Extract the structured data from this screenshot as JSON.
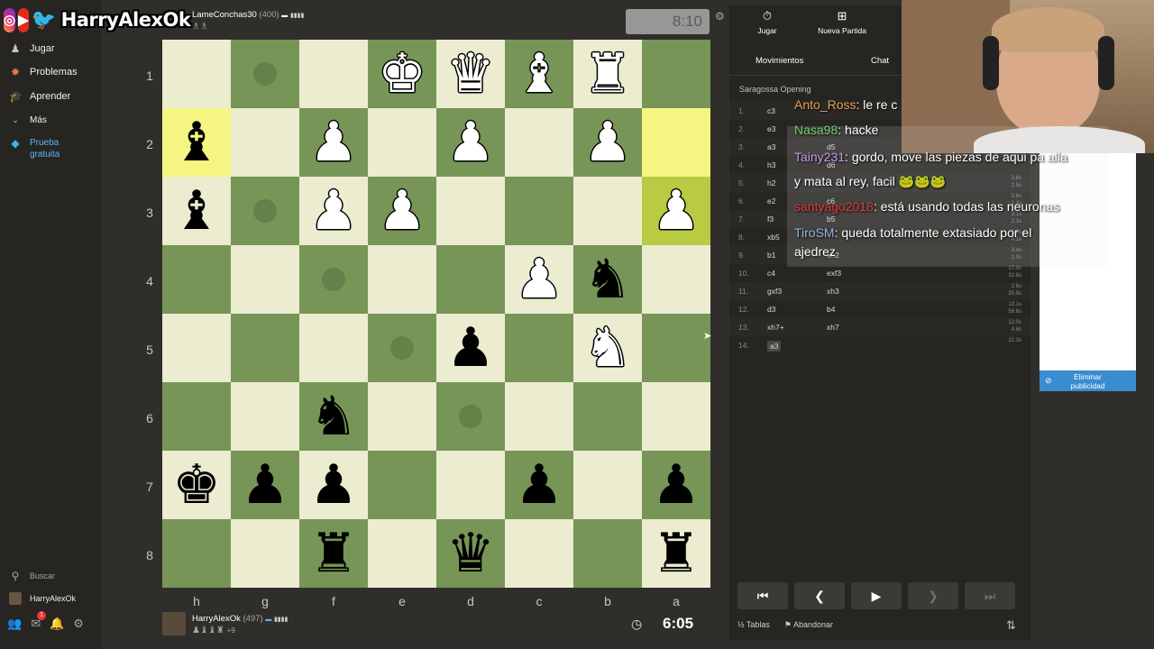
{
  "brand": {
    "name": "HarryAlexOk"
  },
  "sidebar": {
    "items": [
      {
        "label": "Jugar",
        "icon": "pawn-icon"
      },
      {
        "label": "Problemas",
        "icon": "puzzle-icon"
      },
      {
        "label": "Aprender",
        "icon": "graduation-cap-icon"
      },
      {
        "label": "Más",
        "icon": "chevron-down-icon"
      },
      {
        "label": "Prueba gratuita",
        "icon": "diamond-icon"
      }
    ],
    "search_label": "Buscar",
    "user_label": "HarryAlexOk",
    "notifications_count": "1"
  },
  "opponent": {
    "name": "LameConchas30",
    "rating": "(400)",
    "clock": "8:10"
  },
  "player": {
    "name": "HarryAlexOk",
    "rating": "(497)",
    "material": "+9",
    "clock": "6:05"
  },
  "board": {
    "ranks": [
      "1",
      "2",
      "3",
      "4",
      "5",
      "6",
      "7",
      "8"
    ],
    "files": [
      "h",
      "g",
      "f",
      "e",
      "d",
      "c",
      "b",
      "a"
    ],
    "squares": [
      [
        "",
        "dot",
        "",
        "wK",
        "wQ",
        "wB",
        "wR",
        ""
      ],
      [
        "bB",
        "",
        "wP",
        "",
        "wP",
        "",
        "wP",
        "hl"
      ],
      [
        "bB",
        "dot",
        "wP",
        "wP",
        "",
        "",
        "",
        "wP"
      ],
      [
        "",
        "",
        "dot",
        "",
        "",
        "wP",
        "bN",
        ""
      ],
      [
        "",
        "",
        "",
        "dot",
        "bP",
        "",
        "wN",
        ""
      ],
      [
        "",
        "",
        "bN",
        "",
        "dot",
        "",
        "",
        ""
      ],
      [
        "bK",
        "bP",
        "bP",
        "",
        "",
        "bP",
        "",
        "bP"
      ],
      [
        "",
        "",
        "bR",
        "",
        "bQ",
        "",
        "",
        "bR"
      ]
    ]
  },
  "panel": {
    "tab_play": "Jugar",
    "tab_new": "Nueva Partida",
    "tab_moves": "Movimientos",
    "tab_chat": "Chat",
    "opening": "Saragossa Opening",
    "moves": [
      {
        "n": "1.",
        "w": "c3",
        "b": "",
        "t": [
          "",
          ""
        ]
      },
      {
        "n": "2.",
        "w": "e3",
        "b": "",
        "t": [
          "",
          ""
        ]
      },
      {
        "n": "3.",
        "w": "a3",
        "b": "d5",
        "t": [
          "",
          ""
        ]
      },
      {
        "n": "4.",
        "w": "h3",
        "b": "d6",
        "t": [
          "22.0s",
          ""
        ]
      },
      {
        "n": "5.",
        "w": "h2",
        "b": "",
        "t": [
          "2.8s",
          "1.5s"
        ]
      },
      {
        "n": "6.",
        "w": "e2",
        "b": "c6",
        "t": [
          "2.6s",
          "1.2s"
        ]
      },
      {
        "n": "7.",
        "w": "f3",
        "b": "b5",
        "t": [
          "3.1s",
          "2.1s"
        ]
      },
      {
        "n": "8.",
        "w": "xb5",
        "b": "",
        "t": [
          "1.9s",
          "4.1s"
        ]
      },
      {
        "n": "9.",
        "w": "b1",
        "b": "xh2",
        "t": [
          "3.4s",
          "1.0s"
        ]
      },
      {
        "n": "10.",
        "w": "c4",
        "b": "exf3",
        "t": [
          "17.0s",
          "32.8s"
        ]
      },
      {
        "n": "11.",
        "w": "gxf3",
        "b": "xh3",
        "t": [
          "2.6s",
          "25.9s"
        ]
      },
      {
        "n": "12.",
        "w": "d3",
        "b": "b4",
        "t": [
          "13.1s",
          "58.6s"
        ]
      },
      {
        "n": "13.",
        "w": "xh7+",
        "b": "xh7",
        "t": [
          "12.0s",
          "4.6s"
        ]
      },
      {
        "n": "14.",
        "w": "a3",
        "b": "",
        "t": [
          "22.3s",
          ""
        ]
      }
    ],
    "action_draw": "Tablas",
    "action_resign": "Abandonar",
    "ad_button": "Eliminar publicidad"
  },
  "chat": [
    {
      "user": "Anto_Ross",
      "color": "#e8a055",
      "msg": "le re c"
    },
    {
      "user": "Nasa98",
      "color": "#6fd16a",
      "msg": "hacke"
    },
    {
      "user": "Tainy231",
      "color": "#c39ae8",
      "msg": "gordo, move las piezas de aqui pa alla"
    },
    {
      "user": "",
      "color": "#fff",
      "msg": "y mata al rey, facil"
    },
    {
      "user": "santyago2018",
      "color": "#e03a3a",
      "msg": "está usando todas las neuronas"
    },
    {
      "user": "TiroSM",
      "color": "#8fb6e6",
      "msg": "queda totalmente extasiado por el"
    },
    {
      "user": "",
      "color": "#fff",
      "msg": "ajedrez"
    }
  ]
}
